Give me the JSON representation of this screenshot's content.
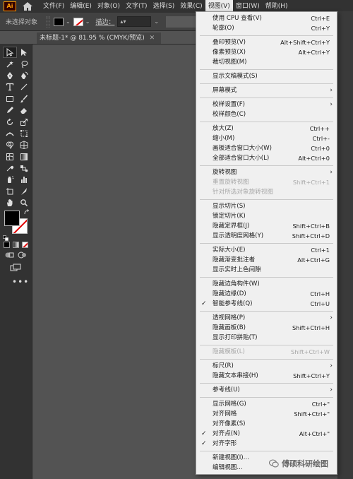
{
  "menubar": {
    "logo": "Ai",
    "items": [
      {
        "label": "文件(F)",
        "active": false
      },
      {
        "label": "编辑(E)",
        "active": false
      },
      {
        "label": "对象(O)",
        "active": false
      },
      {
        "label": "文字(T)",
        "active": false
      },
      {
        "label": "选择(S)",
        "active": false
      },
      {
        "label": "效果(C)",
        "active": false
      },
      {
        "label": "视图(V)",
        "active": true
      },
      {
        "label": "窗口(W)",
        "active": false
      },
      {
        "label": "帮助(H)",
        "active": false
      }
    ]
  },
  "controlbar": {
    "selection_label": "未选择对象",
    "stroke_label": "描边："
  },
  "document": {
    "tab_title": "未标题-1* @ 81.95 % (CMYK/预览)",
    "close_glyph": "✕"
  },
  "colors": {
    "accent_stroke": "#e00000",
    "menubar_bg": "#323232",
    "dropdown_bg": "#f0f0f0",
    "canvas_bg": "#535353"
  },
  "view_menu": {
    "items": [
      {
        "label": "使用 CPU 查看(V)",
        "shortcut": "Ctrl+E"
      },
      {
        "label": "轮廓(O)",
        "shortcut": "Ctrl+Y"
      },
      {
        "sep": true
      },
      {
        "label": "叠印预览(V)",
        "shortcut": "Alt+Shift+Ctrl+Y"
      },
      {
        "label": "像素预览(X)",
        "shortcut": "Alt+Ctrl+Y"
      },
      {
        "label": "裁切视图(M)",
        "shortcut": ""
      },
      {
        "sep": true
      },
      {
        "label": "显示文稿模式(S)",
        "shortcut": ""
      },
      {
        "sep": true
      },
      {
        "label": "屏幕模式",
        "shortcut": "",
        "submenu": true
      },
      {
        "sep": true
      },
      {
        "label": "校样设置(F)",
        "shortcut": "",
        "submenu": true
      },
      {
        "label": "校样颜色(C)",
        "shortcut": ""
      },
      {
        "sep": true
      },
      {
        "label": "放大(Z)",
        "shortcut": "Ctrl++"
      },
      {
        "label": "缩小(M)",
        "shortcut": "Ctrl+-"
      },
      {
        "label": "画板适合窗口大小(W)",
        "shortcut": "Ctrl+0"
      },
      {
        "label": "全部适合窗口大小(L)",
        "shortcut": "Alt+Ctrl+0"
      },
      {
        "sep": true
      },
      {
        "label": "旋转视图",
        "shortcut": "",
        "submenu": true
      },
      {
        "label": "重置旋转视图",
        "shortcut": "Shift+Ctrl+1",
        "disabled": true
      },
      {
        "label": "针对所选对象旋转视图",
        "shortcut": "",
        "disabled": true
      },
      {
        "sep": true
      },
      {
        "label": "显示切片(S)",
        "shortcut": ""
      },
      {
        "label": "锁定切片(K)",
        "shortcut": ""
      },
      {
        "label": "隐藏定界框(J)",
        "shortcut": "Shift+Ctrl+B"
      },
      {
        "label": "显示透明度网格(Y)",
        "shortcut": "Shift+Ctrl+D"
      },
      {
        "sep": true
      },
      {
        "label": "实际大小(E)",
        "shortcut": "Ctrl+1"
      },
      {
        "label": "隐藏渐变批注者",
        "shortcut": "Alt+Ctrl+G"
      },
      {
        "label": "显示实时上色间隙",
        "shortcut": ""
      },
      {
        "sep": true
      },
      {
        "label": "隐藏边角构件(W)",
        "shortcut": ""
      },
      {
        "label": "隐藏边缘(D)",
        "shortcut": "Ctrl+H"
      },
      {
        "label": "智能参考线(Q)",
        "shortcut": "Ctrl+U",
        "checked": true
      },
      {
        "sep": true
      },
      {
        "label": "透视网格(P)",
        "shortcut": "",
        "submenu": true
      },
      {
        "label": "隐藏画板(B)",
        "shortcut": "Shift+Ctrl+H"
      },
      {
        "label": "显示打印拼贴(T)",
        "shortcut": ""
      },
      {
        "sep": true
      },
      {
        "label": "隐藏模板(L)",
        "shortcut": "Shift+Ctrl+W",
        "disabled": true
      },
      {
        "sep": true
      },
      {
        "label": "标尺(R)",
        "shortcut": "",
        "submenu": true
      },
      {
        "label": "隐藏文本串接(H)",
        "shortcut": "Shift+Ctrl+Y"
      },
      {
        "sep": true
      },
      {
        "label": "参考线(U)",
        "shortcut": "",
        "submenu": true
      },
      {
        "sep": true
      },
      {
        "label": "显示网格(G)",
        "shortcut": "Ctrl+\""
      },
      {
        "label": "对齐网格",
        "shortcut": "Shift+Ctrl+\""
      },
      {
        "label": "对齐像素(S)",
        "shortcut": ""
      },
      {
        "label": "对齐点(N)",
        "shortcut": "Alt+Ctrl+\"",
        "checked": true
      },
      {
        "label": "对齐字形",
        "shortcut": "",
        "checked": true
      },
      {
        "sep": true
      },
      {
        "label": "新建视图(I)...",
        "shortcut": ""
      },
      {
        "label": "编辑视图...",
        "shortcut": ""
      }
    ]
  },
  "watermark": {
    "text": "傅硕科研绘图"
  },
  "glyphs": {
    "check": "✓",
    "submenu_arrow": "›",
    "chevron_down": "⌄",
    "more": "•••"
  }
}
